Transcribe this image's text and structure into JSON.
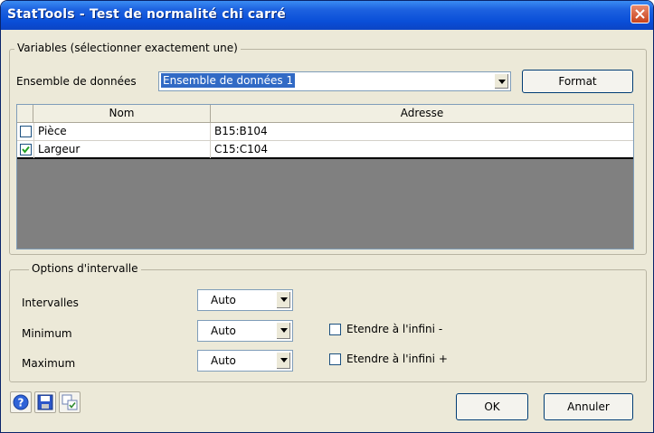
{
  "window": {
    "title": "StatTools - Test de normalité chi carré"
  },
  "variables": {
    "legend": "Variables (sélectionner exactement une)",
    "dataset_label": "Ensemble de données",
    "dataset_value": "Ensemble de données 1",
    "format_label": "Format",
    "columns": [
      "Nom",
      "Adresse"
    ],
    "rows": [
      {
        "checked": false,
        "name": "Pièce",
        "address": "B15:B104"
      },
      {
        "checked": true,
        "name": "Largeur",
        "address": "C15:C104"
      }
    ]
  },
  "options": {
    "legend": "Options d'intervalle",
    "intervals_label": "Intervalles",
    "intervals_value": "Auto",
    "minimum_label": "Minimum",
    "minimum_value": "Auto",
    "maximum_label": "Maximum",
    "maximum_value": "Auto",
    "extend_minus_label": "Etendre à l'infini -",
    "extend_plus_label": "Etendre à l'infini +"
  },
  "footer": {
    "ok_label": "OK",
    "cancel_label": "Annuler"
  },
  "icons": [
    "help-icon",
    "save-icon",
    "preferences-icon",
    "close-icon",
    "chevron-down-icon"
  ]
}
